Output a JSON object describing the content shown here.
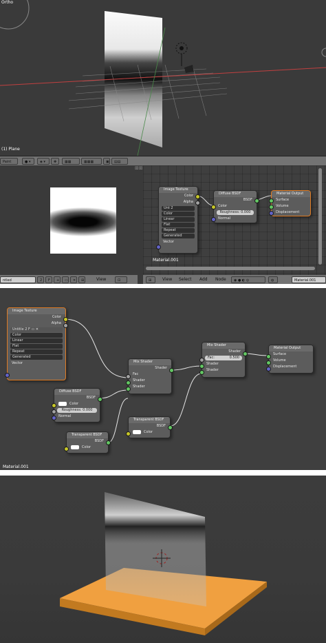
{
  "viewport": {
    "mode_label": "Ortho",
    "object_label": "(1) Plane"
  },
  "toolbar": {
    "mode": "Paint"
  },
  "image_editor": {
    "image_name": "ntled",
    "users": "2",
    "view_menu": "View"
  },
  "node_header": {
    "menus": [
      "View",
      "Select",
      "Add",
      "Node"
    ],
    "material_name": "Material.001"
  },
  "small_editor": {
    "material_label": "Material.001",
    "image_texture": {
      "title": "Image Texture",
      "outputs": [
        "Color",
        "Alpha"
      ],
      "image_name": "Unt",
      "users": "2",
      "options": [
        "Color",
        "Linear",
        "Flat",
        "Repeat",
        "Generated"
      ],
      "input": "Vector"
    },
    "diffuse": {
      "title": "Diffuse BSDF",
      "output": "BSDF",
      "inputs": [
        "Color",
        "Roughness: 0.000",
        "Normal"
      ]
    },
    "output": {
      "title": "Material Output",
      "inputs": [
        "Surface",
        "Volume",
        "Displacement"
      ]
    }
  },
  "node_editor": {
    "material_label": "Material.001",
    "image_texture": {
      "title": "Image Texture",
      "outputs": [
        "Color",
        "Alpha"
      ],
      "image_name": "Untitle",
      "users": "2",
      "options": [
        "Color",
        "Linear",
        "Flat",
        "Repeat",
        "Generated"
      ],
      "input": "Vector"
    },
    "diffuse": {
      "title": "Diffuse BSDF",
      "output": "BSDF",
      "color_label": "Color",
      "roughness": "Roughness: 0.000",
      "normal": "Normal"
    },
    "transparent1": {
      "title": "Transparent BSDF",
      "output": "BSDF",
      "color_label": "Color"
    },
    "mix1": {
      "title": "Mix Shader",
      "output": "Shader",
      "inputs": [
        "Fac",
        "Shader",
        "Shader"
      ]
    },
    "transparent2": {
      "title": "Transparent BSDF",
      "output": "BSDF",
      "color_label": "Color"
    },
    "mix2": {
      "title": "Mix Shader",
      "output": "Shader",
      "fac_label": "Fac:",
      "fac_value": "0.500",
      "inputs": [
        "Shader",
        "Shader"
      ]
    },
    "output": {
      "title": "Material Output",
      "inputs": [
        "Surface",
        "Volume",
        "Displacement"
      ]
    }
  },
  "colors": {
    "accent": "#e07b22",
    "color_socket": "#c7c729",
    "shader_socket": "#63c763",
    "float_socket": "#a1a1a1",
    "vector_socket": "#6363c7",
    "ground_plane": "#f0a040"
  }
}
